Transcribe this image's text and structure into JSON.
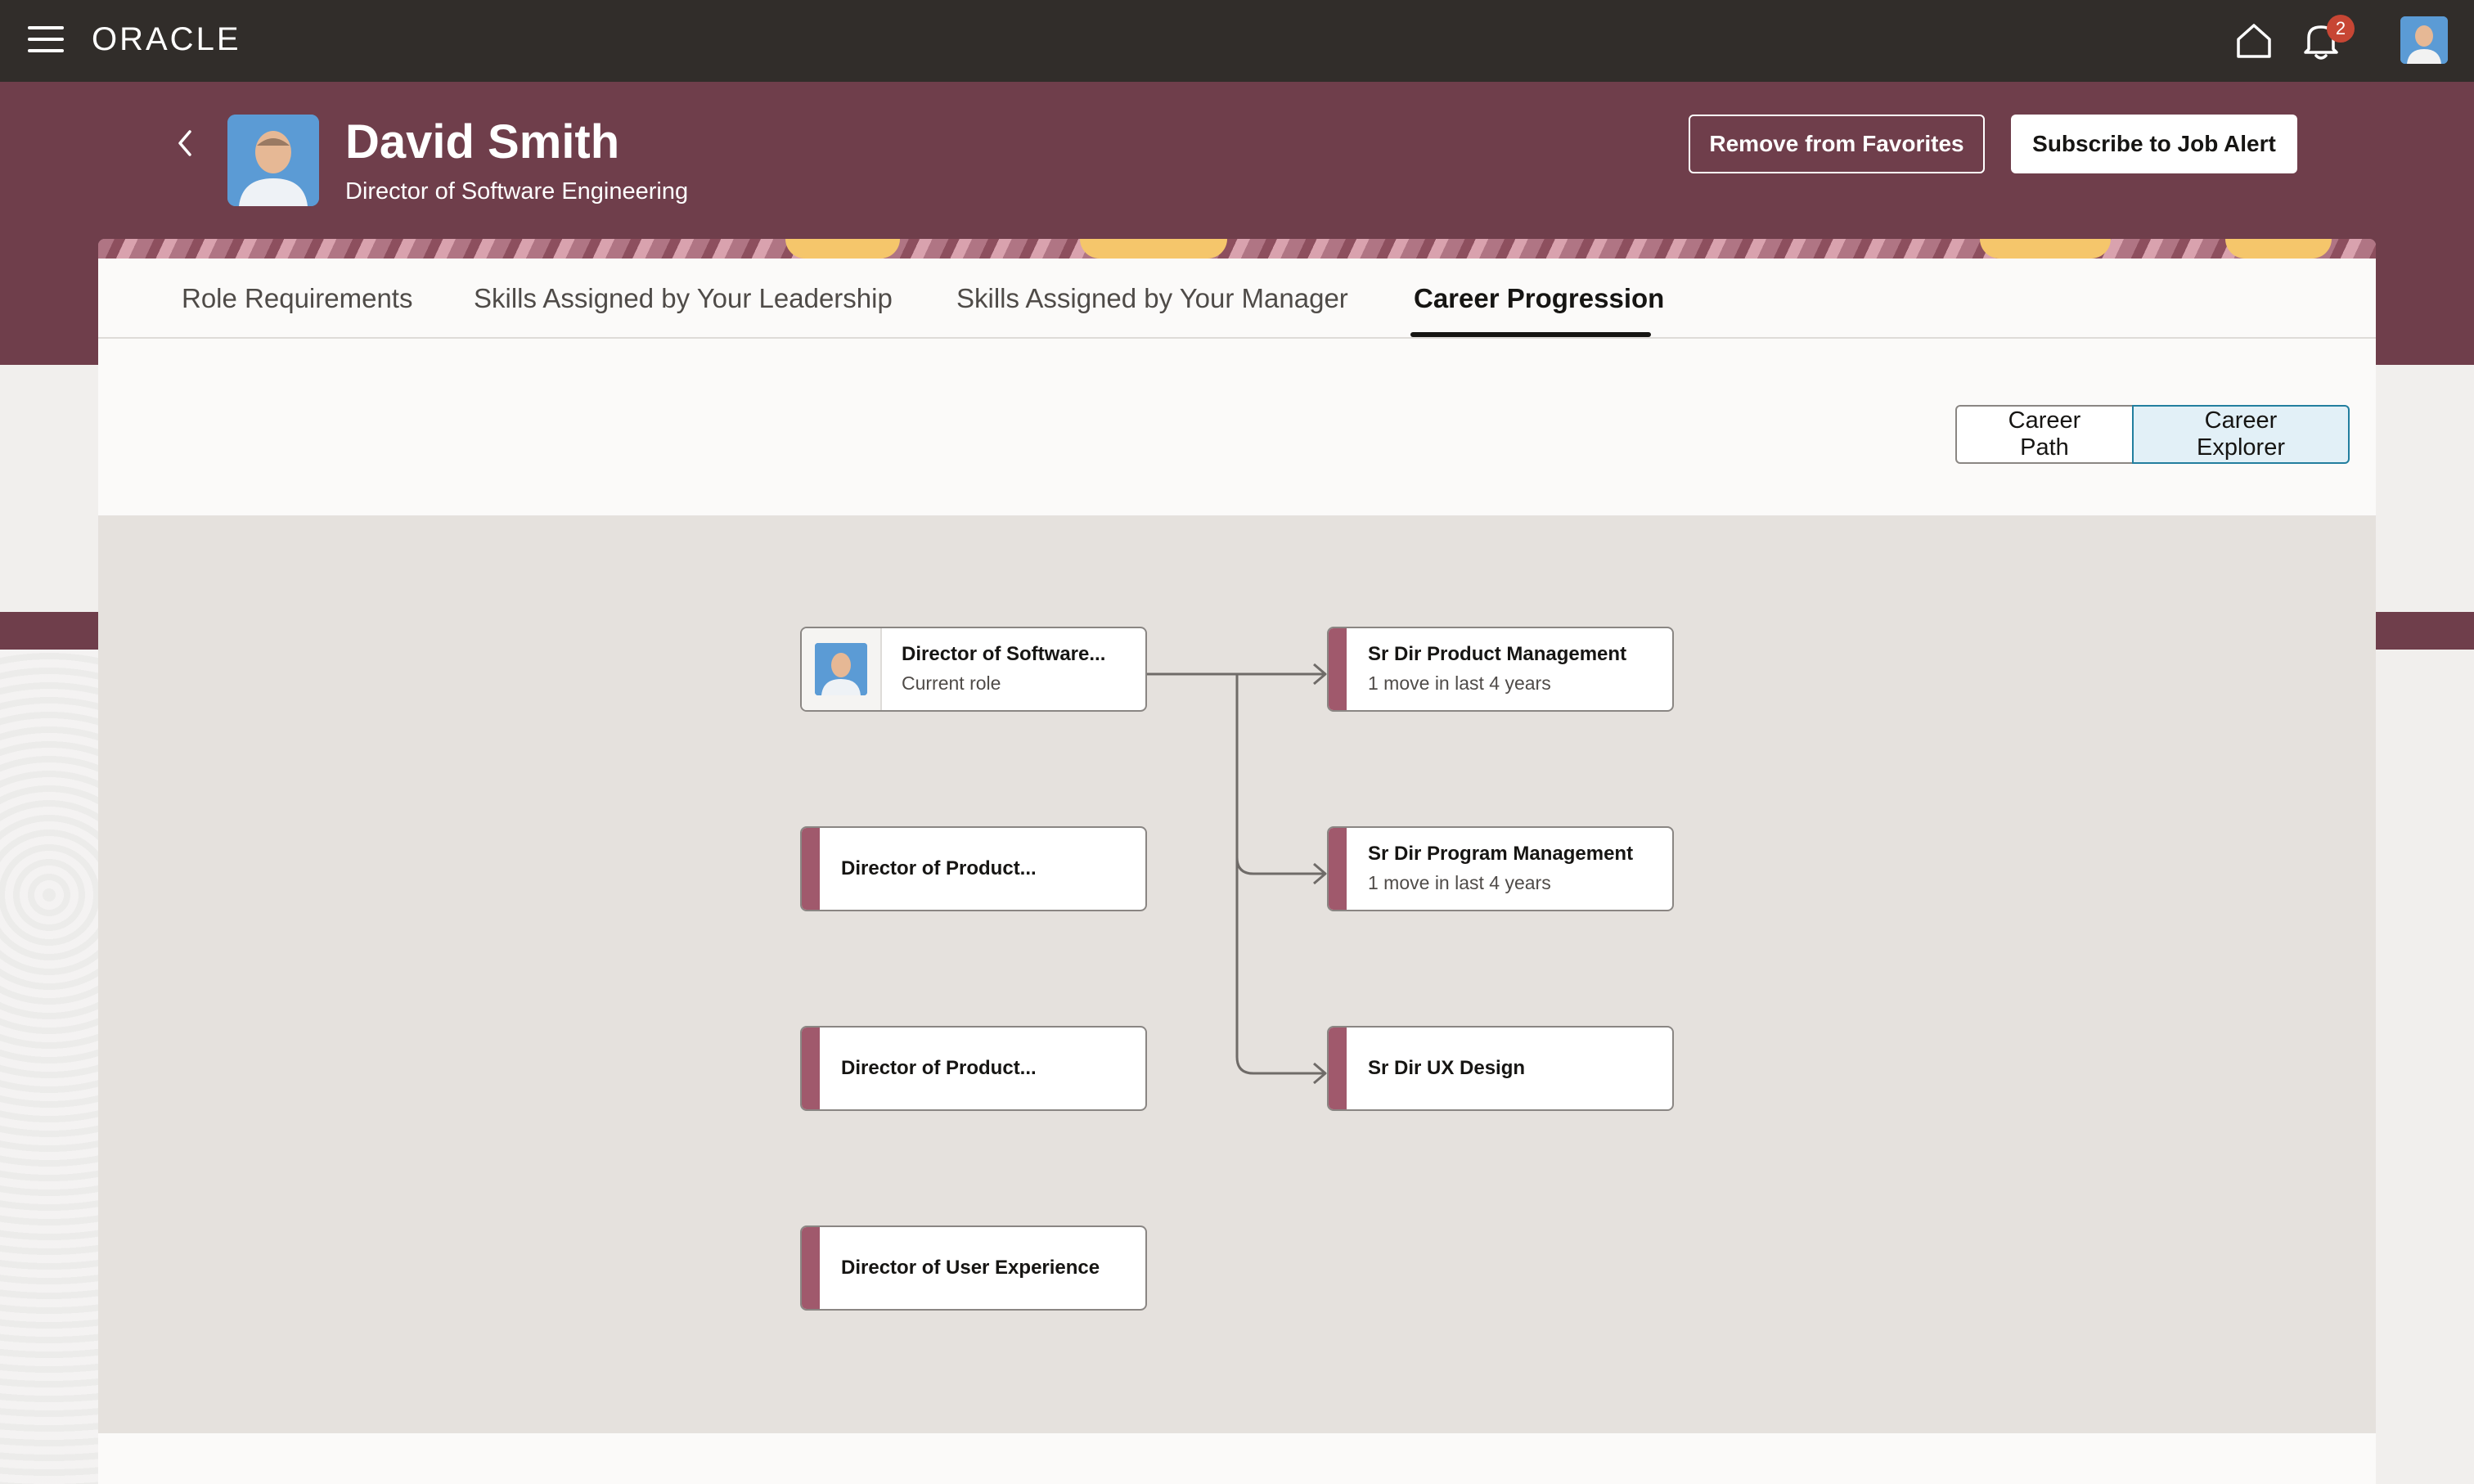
{
  "app": {
    "brand": "ORACLE",
    "notification_count": "2"
  },
  "header": {
    "name": "David Smith",
    "job_title": "Director of Software Engineering",
    "remove_favorites_label": "Remove from Favorites",
    "subscribe_label": "Subscribe to Job Alert"
  },
  "tabs": [
    {
      "label": "Role Requirements",
      "active": false
    },
    {
      "label": "Skills Assigned by Your Leadership",
      "active": false
    },
    {
      "label": "Skills Assigned by Your Manager",
      "active": false
    },
    {
      "label": "Career Progression",
      "active": true
    }
  ],
  "view_toggle": {
    "career_path_label": "Career Path",
    "career_explorer_label": "Career Explorer",
    "selected": "Career Explorer"
  },
  "explorer": {
    "current_role": {
      "title": "Director of Software...",
      "subtitle": "Current role"
    },
    "related_roles": [
      {
        "title": "Director of Product..."
      },
      {
        "title": "Director of Product..."
      },
      {
        "title": "Director of User Experience"
      }
    ],
    "next_roles": [
      {
        "title": "Sr Dir Product Management",
        "subtitle": "1 move in last 4 years"
      },
      {
        "title": "Sr Dir Program Management",
        "subtitle": "1 move in last 4 years"
      },
      {
        "title": "Sr Dir UX Design"
      }
    ]
  },
  "colors": {
    "topbar": "#312d2a",
    "brand_band": "#6f3e4b",
    "card_accent": "#a0596c",
    "selected_toggle": "#e2f0f7",
    "badge": "#c74634"
  }
}
